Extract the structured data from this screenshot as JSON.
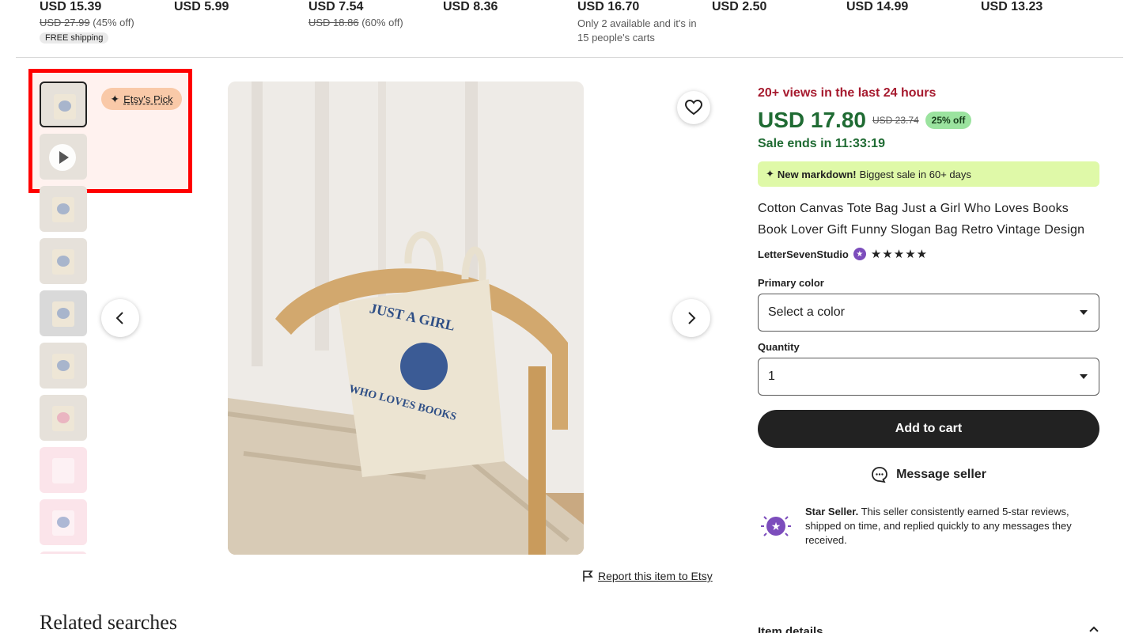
{
  "strip": {
    "items": [
      {
        "price": "USD 15.39",
        "orig": "USD 27.99",
        "off": "(45% off)",
        "badge": "FREE shipping",
        "note": ""
      },
      {
        "price": "USD 5.99",
        "orig": "",
        "off": "",
        "badge": "",
        "note": ""
      },
      {
        "price": "USD 7.54",
        "orig": "USD 18.86",
        "off": "(60% off)",
        "badge": "",
        "note": ""
      },
      {
        "price": "USD 8.36",
        "orig": "",
        "off": "",
        "badge": "",
        "note": ""
      },
      {
        "price": "USD 16.70",
        "orig": "",
        "off": "",
        "badge": "",
        "note": "Only 2 available and it's in 15 people's carts"
      },
      {
        "price": "USD 2.50",
        "orig": "",
        "off": "",
        "badge": "",
        "note": ""
      },
      {
        "price": "USD 14.99",
        "orig": "",
        "off": "",
        "badge": "",
        "note": ""
      },
      {
        "price": "USD 13.23",
        "orig": "",
        "off": "",
        "badge": "",
        "note": ""
      }
    ]
  },
  "gallery": {
    "etsys_pick": "Etsy's Pick",
    "thumb_count": 10,
    "main_image_print": [
      "JUST A GIRL",
      "WHO LOVES BOOKS"
    ]
  },
  "report_link": "Report this item to Etsy",
  "related_heading": "Related searches",
  "buy_box": {
    "views": "20+ views in the last 24 hours",
    "price": "USD 17.80",
    "original_price": "USD 23.74",
    "discount": "25% off",
    "sale_ends": "Sale ends in 11:33:19",
    "markdown_bold": "New markdown!",
    "markdown_text": "Biggest sale in 60+ days",
    "title": "Cotton Canvas Tote Bag Just a Girl Who Loves Books Book Lover Gift Funny Slogan Bag Retro Vintage Design",
    "seller": "LetterSevenStudio",
    "rating_stars": 5,
    "color_label": "Primary color",
    "color_value": "Select a color",
    "quantity_label": "Quantity",
    "quantity_value": "1",
    "add_to_cart": "Add to cart",
    "message_seller": "Message seller",
    "star_seller_bold": "Star Seller.",
    "star_seller_text": "This seller consistently earned 5-star reviews, shipped on time, and replied quickly to any messages they received.",
    "item_details": "Item details"
  },
  "colors": {
    "price_green": "#1f6b33",
    "views_red": "#a61a2e",
    "highlight": "#ff0000"
  }
}
